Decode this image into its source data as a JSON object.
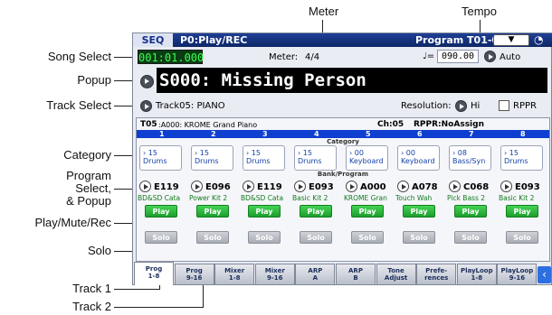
{
  "callouts": {
    "meter": "Meter",
    "tempo": "Tempo",
    "song_select": "Song Select",
    "popup": "Popup",
    "track_select": "Track Select",
    "category": "Category",
    "program_select_1": "Program",
    "program_select_2": "Select,",
    "program_select_3": "& Popup",
    "play_mute_rec": "Play/Mute/Rec",
    "solo": "Solo",
    "track1": "Track 1",
    "track2": "Track 2"
  },
  "header": {
    "mode": "SEQ",
    "page": "P0:Play/REC",
    "program_label": "Program T01-08"
  },
  "transport": {
    "position": "001:01.000",
    "meter_label": "Meter:",
    "meter_value": "4/4",
    "tempo_symbol": "♩=",
    "tempo_value": "090.00",
    "tempo_mode": "Auto"
  },
  "song": {
    "name": "S000: Missing Person"
  },
  "track_select": {
    "value": "Track05: PIANO",
    "resolution_label": "Resolution:",
    "resolution_value": "Hi",
    "rppr_label": "RPPR"
  },
  "info": {
    "track": "T05",
    "program": ":A000: KROME Grand Piano",
    "channel": "Ch:05",
    "rppr": "RPPR:NoAssign"
  },
  "section_labels": {
    "category": "Category",
    "bank_program": "Bank/Program"
  },
  "tracks": [
    {
      "num": "1",
      "cat_num": "15",
      "cat_name": "Drums",
      "prog": "E119",
      "prog_name": "BD&SD Cata",
      "play": "Play",
      "solo": "Solo"
    },
    {
      "num": "2",
      "cat_num": "15",
      "cat_name": "Drums",
      "prog": "E096",
      "prog_name": "Power Kit 2",
      "play": "Play",
      "solo": "Solo"
    },
    {
      "num": "3",
      "cat_num": "15",
      "cat_name": "Drums",
      "prog": "E119",
      "prog_name": "BD&SD Cata",
      "play": "Play",
      "solo": "Solo"
    },
    {
      "num": "4",
      "cat_num": "15",
      "cat_name": "Drums",
      "prog": "E093",
      "prog_name": "Basic Kit 2",
      "play": "Play",
      "solo": "Solo"
    },
    {
      "num": "5",
      "cat_num": "00",
      "cat_name": "Keyboard",
      "prog": "A000",
      "prog_name": "KROME Gran",
      "play": "Play",
      "solo": "Solo"
    },
    {
      "num": "6",
      "cat_num": "00",
      "cat_name": "Keyboard",
      "prog": "A078",
      "prog_name": "Touch Wah",
      "play": "Play",
      "solo": "Solo"
    },
    {
      "num": "7",
      "cat_num": "08",
      "cat_name": "Bass/Syn",
      "prog": "C068",
      "prog_name": "Pick Bass 2",
      "play": "Play",
      "solo": "Solo"
    },
    {
      "num": "8",
      "cat_num": "15",
      "cat_name": "Drums",
      "prog": "E093",
      "prog_name": "Basic Kit 2",
      "play": "Play",
      "solo": "Solo"
    }
  ],
  "tabs": [
    {
      "l1": "Prog",
      "l2": "1-8"
    },
    {
      "l1": "Prog",
      "l2": "9-16"
    },
    {
      "l1": "Mixer",
      "l2": "1-8"
    },
    {
      "l1": "Mixer",
      "l2": "9-16"
    },
    {
      "l1": "ARP",
      "l2": "A"
    },
    {
      "l1": "ARP",
      "l2": "B"
    },
    {
      "l1": "Tone",
      "l2": "Adjust"
    },
    {
      "l1": "Prefe-",
      "l2": "rences"
    },
    {
      "l1": "PlayLoop",
      "l2": "1-8"
    },
    {
      "l1": "PlayLoop",
      "l2": "9-16"
    }
  ],
  "colors": {
    "header": "#0d2766",
    "play": "#28b43a",
    "solo": "#a7abb3",
    "position_led": "#27c43a"
  }
}
